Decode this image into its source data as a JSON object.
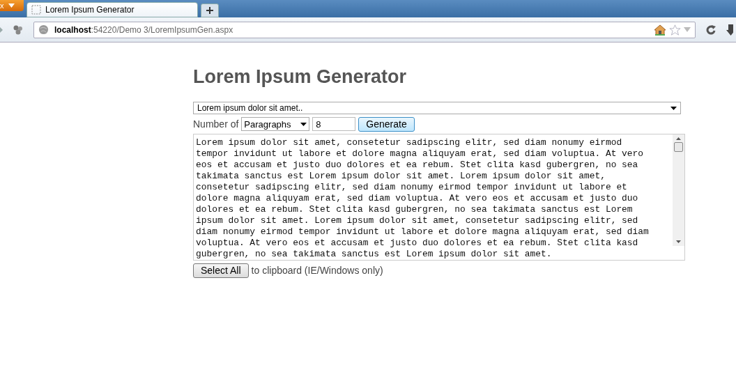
{
  "browser": {
    "menu_button": {
      "label": "x"
    },
    "tabs": [
      {
        "title": "Lorem Ipsum Generator",
        "selected": true
      }
    ],
    "address": {
      "host": "localhost",
      "path": ":54220/Demo 3/LoremIpsumGen.aspx"
    }
  },
  "page": {
    "title": "Lorem Ipsum Generator",
    "preset": {
      "value": "Lorem ipsum dolor sit amet.."
    },
    "count_label": "Number of",
    "unit": {
      "value": "Paragraphs"
    },
    "count": {
      "value": "8"
    },
    "generate_button": "Generate",
    "output_lines": [
      "Lorem ipsum dolor sit amet, consetetur sadipscing elitr, sed diam nonumy eirmod",
      "tempor invidunt ut labore et dolore magna aliquyam erat, sed diam voluptua. At vero",
      "eos et accusam et justo duo dolores et ea rebum. Stet clita kasd gubergren, no sea",
      "takimata sanctus est Lorem ipsum dolor sit amet. Lorem ipsum dolor sit amet,",
      "consetetur sadipscing elitr, sed diam nonumy eirmod tempor invidunt ut labore et",
      "dolore magna aliquyam erat, sed diam voluptua. At vero eos et accusam et justo duo",
      "dolores et ea rebum. Stet clita kasd gubergren, no sea takimata sanctus est Lorem",
      "ipsum dolor sit amet. Lorem ipsum dolor sit amet, consetetur sadipscing elitr, sed",
      "diam nonumy eirmod tempor invidunt ut labore et dolore magna aliquyam erat, sed diam",
      "voluptua. At vero eos et accusam et justo duo dolores et ea rebum. Stet clita kasd",
      "gubergren, no sea takimata sanctus est Lorem ipsum dolor sit amet."
    ],
    "select_all_button": "Select All",
    "clipboard_note": "to clipboard (IE/Windows only)"
  }
}
